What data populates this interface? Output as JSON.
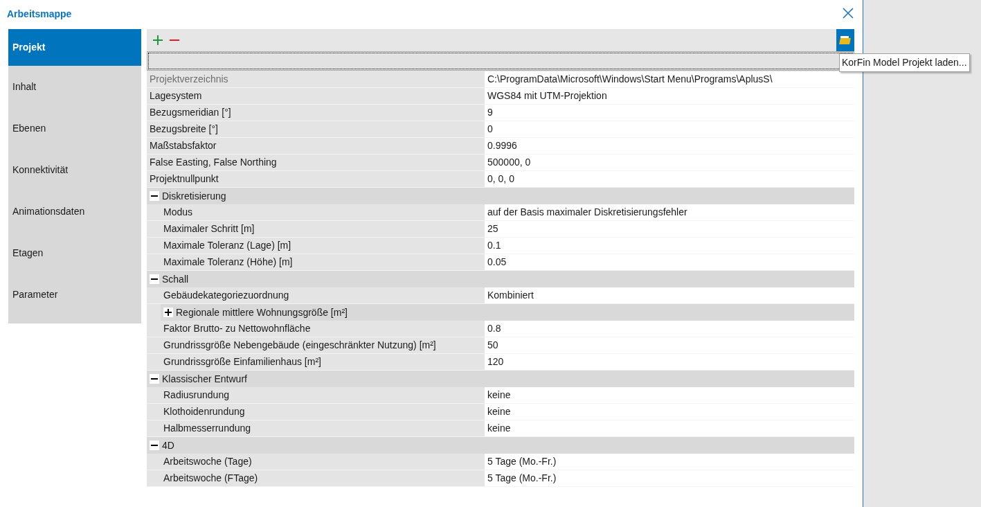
{
  "window": {
    "title": "Arbeitsmappe"
  },
  "sidebar": {
    "items": [
      {
        "label": "Projekt",
        "selected": true
      },
      {
        "label": "Inhalt",
        "selected": false
      },
      {
        "label": "Ebenen",
        "selected": false
      },
      {
        "label": "Konnektivität",
        "selected": false
      },
      {
        "label": "Animationsdaten",
        "selected": false
      },
      {
        "label": "Etagen",
        "selected": false
      },
      {
        "label": "Parameter",
        "selected": false
      }
    ]
  },
  "tooltip": "KorFin Model Projekt laden...",
  "properties": [
    {
      "kind": "property",
      "label": "Projektverzeichnis",
      "value": "C:\\ProgramData\\Microsoft\\Windows\\Start Menu\\Programs\\AplusS\\",
      "disabled": true
    },
    {
      "kind": "property",
      "label": "Lagesystem",
      "value": "WGS84 mit UTM-Projektion",
      "disabled": false
    },
    {
      "kind": "property",
      "label": "Bezugsmeridian [°]",
      "value": "9",
      "disabled": false
    },
    {
      "kind": "property",
      "label": "Bezugsbreite [°]",
      "value": "0",
      "disabled": false
    },
    {
      "kind": "property",
      "label": "Maßstabsfaktor",
      "value": "0.9996",
      "disabled": false
    },
    {
      "kind": "property",
      "label": "False Easting, False Northing",
      "value": "500000, 0",
      "disabled": false
    },
    {
      "kind": "property",
      "label": "Projektnullpunkt",
      "value": "0, 0, 0",
      "disabled": false
    },
    {
      "kind": "category",
      "label": "Diskretisierung",
      "expanded": true,
      "children": [
        {
          "kind": "property",
          "label": "Modus",
          "value": "auf der Basis maximaler Diskretisierungsfehler",
          "disabled": false
        },
        {
          "kind": "property",
          "label": "Maximaler Schritt [m]",
          "value": "25",
          "disabled": false
        },
        {
          "kind": "property",
          "label": "Maximale Toleranz (Lage) [m]",
          "value": "0.1",
          "disabled": false
        },
        {
          "kind": "property",
          "label": "Maximale Toleranz (Höhe) [m]",
          "value": "0.05",
          "disabled": false
        }
      ]
    },
    {
      "kind": "category",
      "label": "Schall",
      "expanded": true,
      "children": [
        {
          "kind": "property",
          "label": "Gebäudekategoriezuordnung",
          "value": "Kombiniert",
          "disabled": false
        },
        {
          "kind": "category",
          "label": "Regionale mittlere Wohnungsgröße [m²]",
          "expanded": false
        },
        {
          "kind": "property",
          "label": "Faktor Brutto- zu Nettowohnfläche",
          "value": "0.8",
          "disabled": false
        },
        {
          "kind": "property",
          "label": "Grundrissgröße Nebengebäude (eingeschränkter Nutzung) [m²]",
          "value": "50",
          "disabled": false
        },
        {
          "kind": "property",
          "label": "Grundrissgröße Einfamilienhaus [m²]",
          "value": "120",
          "disabled": false
        }
      ]
    },
    {
      "kind": "category",
      "label": "Klassischer Entwurf",
      "expanded": true,
      "children": [
        {
          "kind": "property",
          "label": "Radiusrundung",
          "value": "keine",
          "disabled": false
        },
        {
          "kind": "property",
          "label": "Klothoidenrundung",
          "value": "keine",
          "disabled": false
        },
        {
          "kind": "property",
          "label": "Halbmesserrundung",
          "value": "keine",
          "disabled": false
        }
      ]
    },
    {
      "kind": "category",
      "label": "4D",
      "expanded": true,
      "children": [
        {
          "kind": "property",
          "label": "Arbeitswoche (Tage)",
          "value": "5 Tage (Mo.-Fr.)",
          "disabled": false
        },
        {
          "kind": "property",
          "label": "Arbeitswoche (FTage)",
          "value": "5 Tage (Mo.-Fr.)",
          "disabled": false
        }
      ]
    }
  ]
}
